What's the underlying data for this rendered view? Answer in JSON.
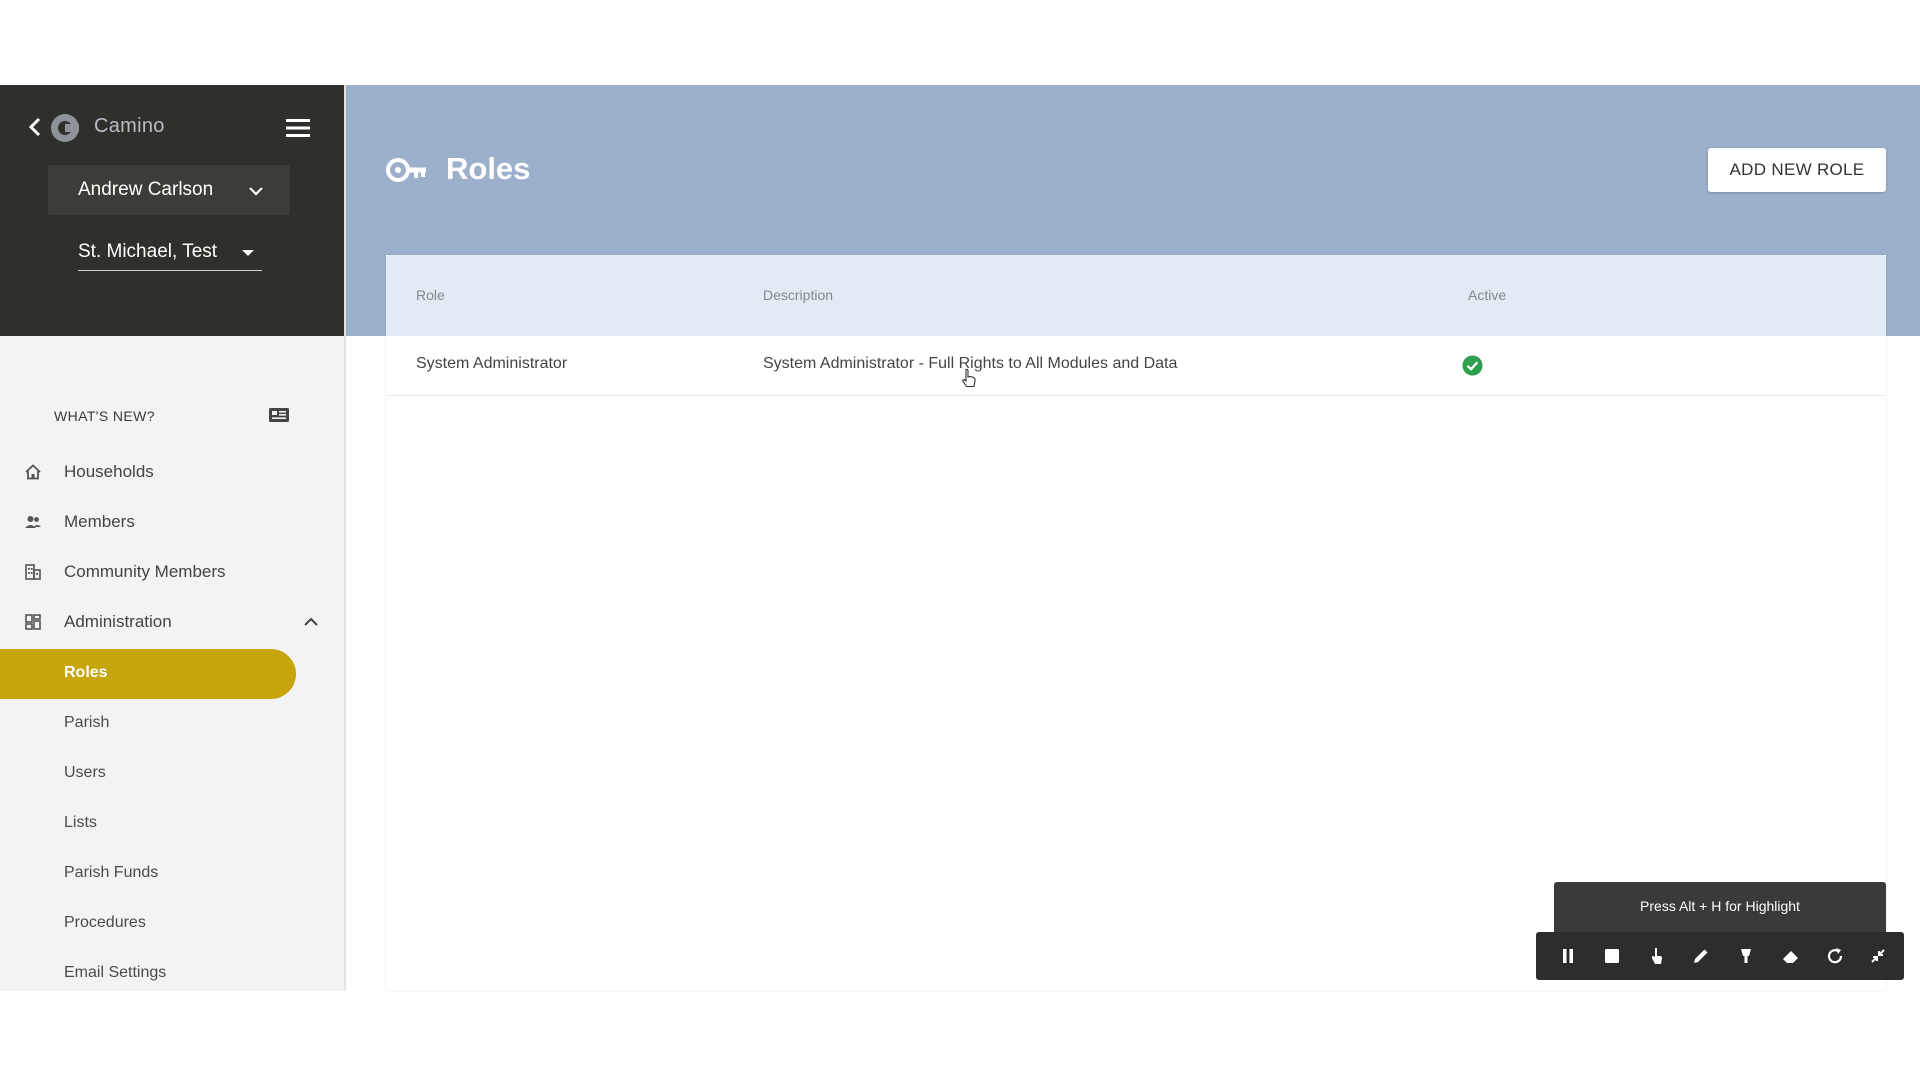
{
  "sidebar": {
    "brand": "Camino",
    "user_name": "Andrew Carlson",
    "parish_name": "St. Michael, Test",
    "whats_new": "WHAT'S NEW?",
    "nav": [
      {
        "label": "Households",
        "icon": "home-icon"
      },
      {
        "label": "Members",
        "icon": "people-icon"
      },
      {
        "label": "Community Members",
        "icon": "building-icon"
      },
      {
        "label": "Administration",
        "icon": "dashboard-icon"
      }
    ],
    "admin_items": [
      {
        "label": "Roles",
        "active": true
      },
      {
        "label": "Parish",
        "active": false
      },
      {
        "label": "Users",
        "active": false
      },
      {
        "label": "Lists",
        "active": false
      },
      {
        "label": "Parish Funds",
        "active": false
      },
      {
        "label": "Procedures",
        "active": false
      },
      {
        "label": "Email Settings",
        "active": false
      }
    ],
    "active_color": "#c6a50d"
  },
  "header": {
    "title": "Roles",
    "add_button_label": "ADD NEW ROLE",
    "bg_color": "#9cb0cc"
  },
  "table": {
    "columns": [
      "Role",
      "Description",
      "Active"
    ],
    "rows": [
      {
        "role": "System Administrator",
        "description": "System Administrator - Full Rights to All Modules and Data",
        "active": true
      }
    ]
  },
  "recorder": {
    "tip": "Press Alt + H for Highlight",
    "buttons": [
      "pause-icon",
      "stop-icon",
      "pointer-icon",
      "pen-icon",
      "highlight-icon",
      "eraser-icon",
      "redo-icon",
      "minimize-icon"
    ]
  }
}
